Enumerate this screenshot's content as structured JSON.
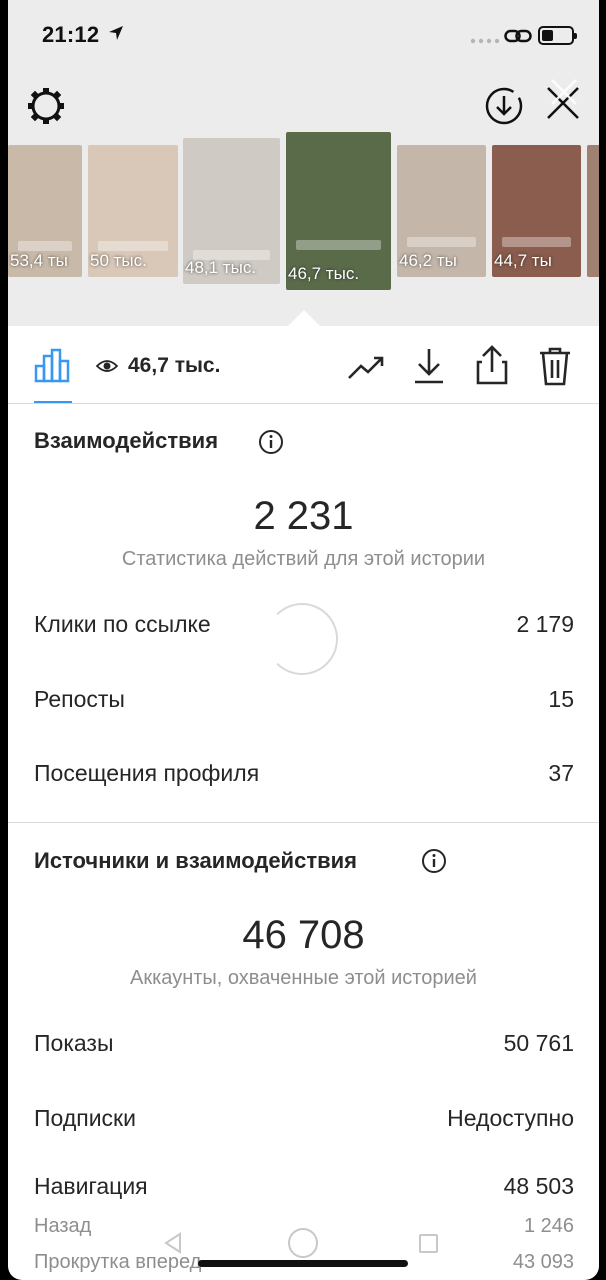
{
  "status_bar": {
    "time": "21:12"
  },
  "thumbnails": [
    {
      "views": "53,4 ты",
      "bg": "#c9b9a9"
    },
    {
      "views": "50 тыс.",
      "bg": "#d9c8b8"
    },
    {
      "views": "48,1 тыс.",
      "bg": "#cfcac4"
    },
    {
      "views": "46,7 тыс.",
      "bg": "#5a6b4a"
    },
    {
      "views": "46,2 ты",
      "bg": "#c4b7aa"
    },
    {
      "views": "44,7 ты",
      "bg": "#8a5d4e"
    },
    {
      "views": "",
      "bg": "#a08070"
    }
  ],
  "toolbar": {
    "views": "46,7 тыс."
  },
  "interactions": {
    "title": "Взаимодействия",
    "total": "2 231",
    "subtitle": "Статистика действий для этой истории",
    "rows": [
      {
        "label": "Клики по ссылке",
        "value": "2 179"
      },
      {
        "label": "Репосты",
        "value": "15"
      },
      {
        "label": "Посещения профиля",
        "value": "37"
      }
    ]
  },
  "discovery": {
    "title": "Источники и взаимодействия",
    "total": "46 708",
    "subtitle": "Аккаунты, охваченные этой историей",
    "rows": [
      {
        "label": "Показы",
        "value": "50 761"
      },
      {
        "label": "Подписки",
        "value": "Недоступно"
      },
      {
        "label": "Навигация",
        "value": "48 503"
      }
    ],
    "sub_rows": [
      {
        "label": "Назад",
        "value": "1 246"
      },
      {
        "label": "Прокрутка вперед",
        "value": "43 093"
      }
    ]
  },
  "colors": {
    "accent": "#3897f0",
    "text": "#262626",
    "muted": "#8e8e8e"
  }
}
